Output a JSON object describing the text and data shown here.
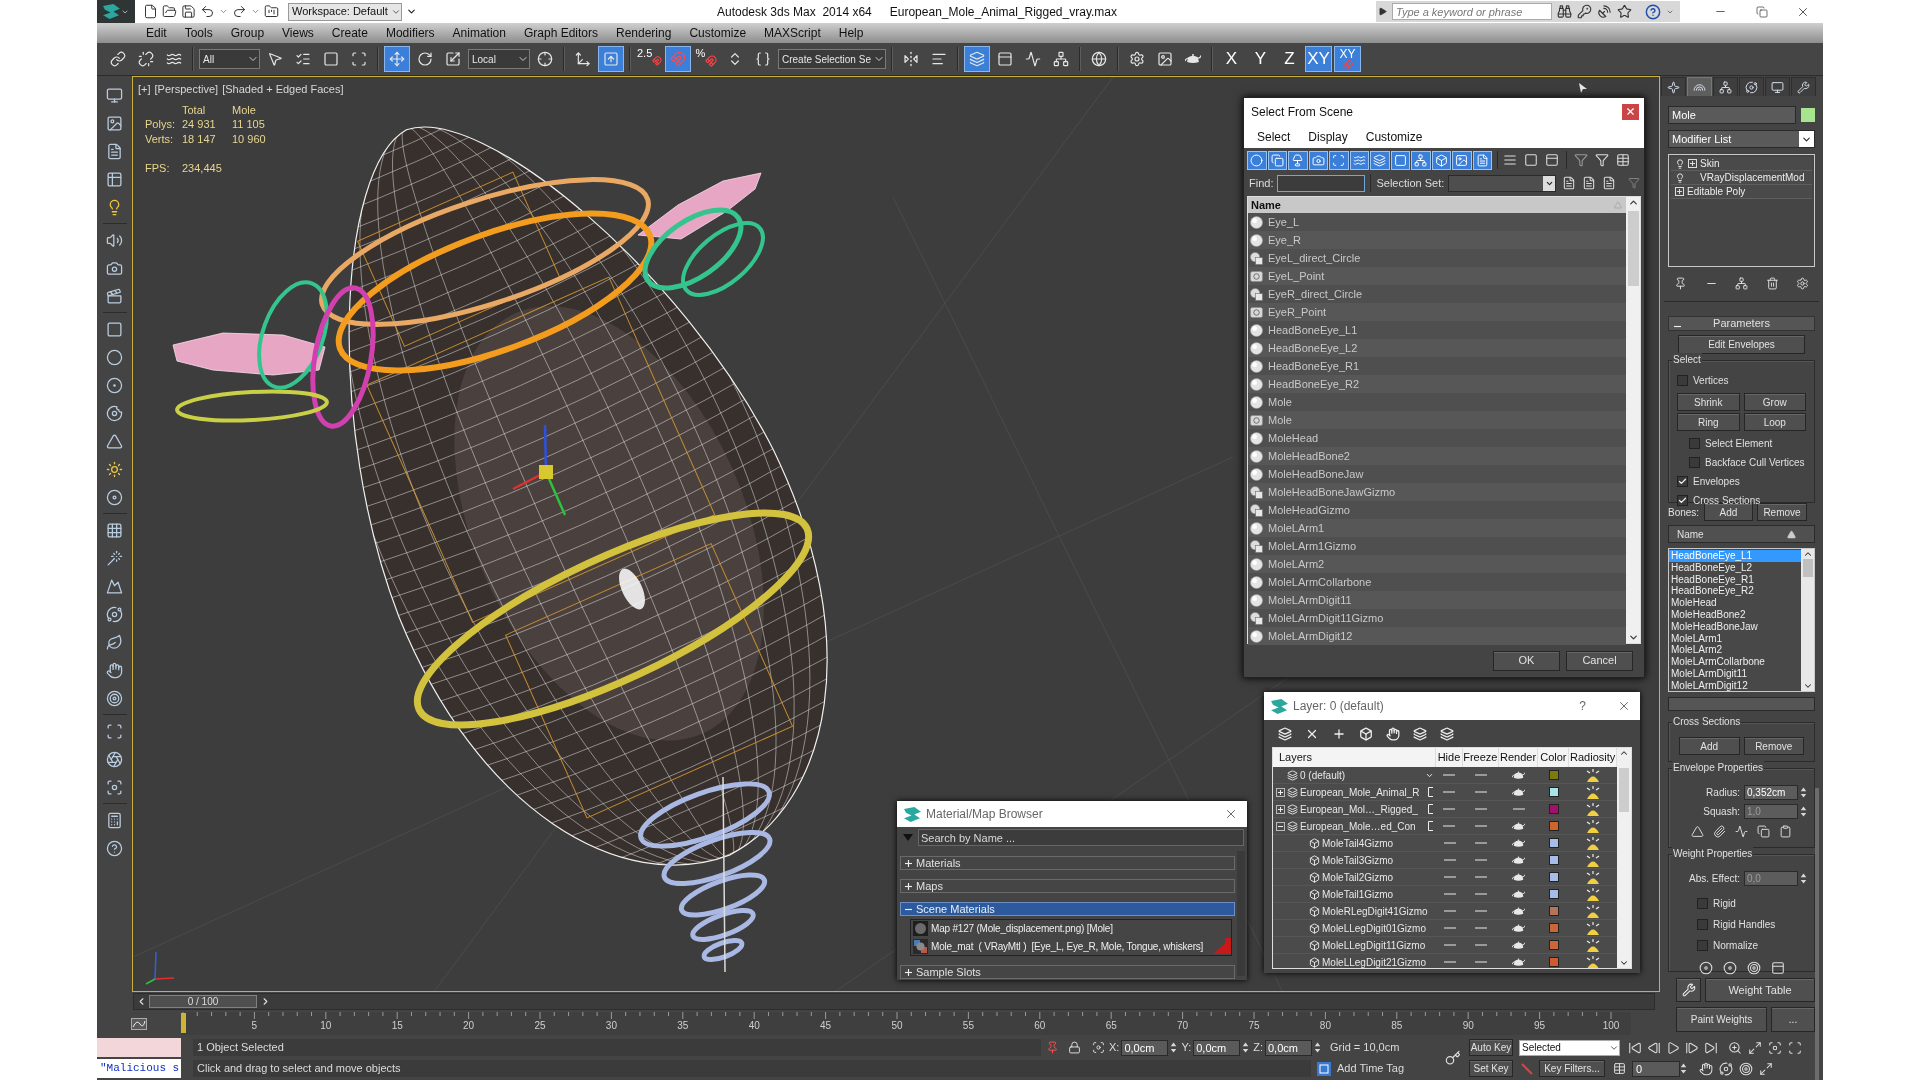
{
  "title_bar": {
    "workspace": "Workspace: Default",
    "app_title": "Autodesk 3ds Max  2014 x64",
    "file_name": "European_Mole_Animal_Rigged_vray.max",
    "search": {
      "placeholder": "Type a keyword or phrase"
    }
  },
  "menu": [
    "Edit",
    "Tools",
    "Group",
    "Views",
    "Create",
    "Modifiers",
    "Animation",
    "Graph Editors",
    "Rendering",
    "Customize",
    "MAXScript",
    "Help"
  ],
  "main_toolbar": [
    {
      "kind": "link",
      "selected": false
    },
    {
      "kind": "unlink",
      "selected": false
    },
    {
      "kind": "bind",
      "selected": false
    },
    {
      "kind": "dropdown",
      "value": "All"
    },
    {
      "kind": "select",
      "selected": false
    },
    {
      "kind": "select-by-name",
      "selected": false
    },
    {
      "kind": "region",
      "selected": false
    },
    {
      "kind": "crossing",
      "selected": false
    },
    {
      "kind": "move",
      "selected": true
    },
    {
      "kind": "rotate",
      "selected": false
    },
    {
      "kind": "scale",
      "selected": false
    },
    {
      "kind": "dropdown",
      "value": "Local"
    },
    {
      "kind": "pivot",
      "selected": false
    },
    {
      "kind": "manipulate",
      "selected": false
    },
    {
      "kind": "shortcut",
      "selected": true
    },
    {
      "kind": "snap",
      "label": "2.5",
      "selected": false
    },
    {
      "kind": "angle-snap",
      "selected": true
    },
    {
      "kind": "snap",
      "label": "%",
      "selected": false
    },
    {
      "kind": "spinner-snap",
      "selected": false
    },
    {
      "kind": "named-sets",
      "selected": false
    },
    {
      "kind": "dropdown",
      "value": "Create Selection Se"
    },
    {
      "kind": "mirror",
      "selected": false
    },
    {
      "kind": "align",
      "selected": false
    },
    {
      "kind": "layers",
      "selected": true
    },
    {
      "kind": "ribbon",
      "selected": false
    },
    {
      "kind": "curve-editor",
      "selected": false
    },
    {
      "kind": "schematic",
      "selected": false
    },
    {
      "kind": "material-editor",
      "selected": false
    },
    {
      "kind": "render-setup",
      "selected": false
    },
    {
      "kind": "frame-window",
      "selected": false
    },
    {
      "kind": "render",
      "selected": false
    },
    {
      "kind": "axis",
      "label": "X",
      "selected": false
    },
    {
      "kind": "axis",
      "label": "Y",
      "selected": false
    },
    {
      "kind": "axis",
      "label": "Z",
      "selected": false
    },
    {
      "kind": "axis",
      "label": "XY",
      "selected": true
    },
    {
      "kind": "axis-snap",
      "label": "XY",
      "selected": true
    }
  ],
  "viewport": {
    "labels": [
      "[+]",
      "[Perspective]",
      "[Shaded + Edged Faces]"
    ],
    "stats": {
      "columns": [
        "Total",
        "Mole"
      ],
      "rows": [
        {
          "label": "Polys:",
          "values": [
            "24 931",
            "11 105"
          ]
        },
        {
          "label": "Verts:",
          "values": [
            "18 147",
            "10 960"
          ]
        }
      ],
      "fps": {
        "label": "FPS:",
        "value": "234,445"
      }
    }
  },
  "select_from_scene": {
    "title": "Select From Scene",
    "menu": [
      "Select",
      "Display",
      "Customize"
    ],
    "filters": [
      {
        "selected": true
      },
      {
        "selected": true
      },
      {
        "selected": true
      },
      {
        "selected": true
      },
      {
        "selected": true
      },
      {
        "selected": true
      },
      {
        "selected": true
      },
      {
        "selected": true
      },
      {
        "selected": true
      },
      {
        "selected": true
      },
      {
        "selected": true
      },
      {
        "selected": true
      }
    ],
    "find_label": "Find:",
    "selection_set_label": "Selection Set:",
    "column": "Name",
    "rows": [
      {
        "name": "Eye_L",
        "kind": "geometry",
        "selected": false
      },
      {
        "name": "Eye_R",
        "kind": "geometry",
        "selected": false
      },
      {
        "name": "EyeL_direct_Circle",
        "kind": "shape",
        "selected": false
      },
      {
        "name": "EyeL_Point",
        "kind": "helper",
        "selected": false
      },
      {
        "name": "EyeR_direct_Circle",
        "kind": "shape",
        "selected": false
      },
      {
        "name": "EyeR_Point",
        "kind": "helper",
        "selected": false
      },
      {
        "name": "HeadBoneEye_L1",
        "kind": "geometry",
        "selected": false
      },
      {
        "name": "HeadBoneEye_L2",
        "kind": "geometry",
        "selected": false
      },
      {
        "name": "HeadBoneEye_R1",
        "kind": "geometry",
        "selected": false
      },
      {
        "name": "HeadBoneEye_R2",
        "kind": "geometry",
        "selected": false
      },
      {
        "name": "Mole",
        "kind": "geometry",
        "selected": false
      },
      {
        "name": "Mole",
        "kind": "helper",
        "selected": false
      },
      {
        "name": "MoleHead",
        "kind": "geometry",
        "selected": false
      },
      {
        "name": "MoleHeadBone2",
        "kind": "geometry",
        "selected": false
      },
      {
        "name": "MoleHeadBoneJaw",
        "kind": "geometry",
        "selected": false
      },
      {
        "name": "MoleHeadBoneJawGizmo",
        "kind": "shape",
        "selected": false
      },
      {
        "name": "MoleHeadGizmo",
        "kind": "shape",
        "selected": false
      },
      {
        "name": "MoleLArm1",
        "kind": "geometry",
        "selected": false
      },
      {
        "name": "MoleLArm1Gizmo",
        "kind": "shape",
        "selected": false
      },
      {
        "name": "MoleLArm2",
        "kind": "geometry",
        "selected": false
      },
      {
        "name": "MoleLArmCollarbone",
        "kind": "geometry",
        "selected": false
      },
      {
        "name": "MoleLArmDigit11",
        "kind": "geometry",
        "selected": false
      },
      {
        "name": "MoleLArmDigit11Gizmo",
        "kind": "shape",
        "selected": false
      },
      {
        "name": "MoleLArmDigit12",
        "kind": "geometry",
        "selected": false
      }
    ],
    "buttons": [
      "OK",
      "Cancel"
    ]
  },
  "command_panel": {
    "tabs": [
      {
        "selected": false
      },
      {
        "selected": true
      },
      {
        "selected": false
      },
      {
        "selected": false
      },
      {
        "selected": false
      },
      {
        "selected": false
      }
    ],
    "object": {
      "name": "Mole",
      "color": "#a6e48e"
    },
    "modifier_list": "Modifier List",
    "stack": [
      {
        "name": "Skin",
        "kind": "modifier",
        "expanded": false
      },
      {
        "name": "VRayDisplacementMod",
        "kind": "modifier"
      },
      {
        "name": "Editable Poly",
        "kind": "base",
        "expanded": false
      }
    ],
    "parameters": {
      "title": "Parameters",
      "edit_envelopes": "Edit Envelopes",
      "select_title": "Select",
      "vertices": {
        "label": "Vertices",
        "checked": false
      },
      "select_buttons": [
        "Shrink",
        "Grow",
        "Ring",
        "Loop"
      ],
      "options": [
        {
          "label": "Select Element",
          "checked": false
        },
        {
          "label": "Backface Cull Vertices",
          "checked": false
        },
        {
          "label": "Envelopes",
          "checked": true
        },
        {
          "label": "Cross Sections",
          "checked": true
        }
      ],
      "bones_label": "Bones:",
      "bones_buttons": [
        "Add",
        "Remove"
      ],
      "bones_column": "Name",
      "bones": [
        {
          "name": "HeadBoneEye_L1",
          "selected": true
        },
        {
          "name": "HeadBoneEye_L2",
          "selected": false
        },
        {
          "name": "HeadBoneEye_R1",
          "selected": false
        },
        {
          "name": "HeadBoneEye_R2",
          "selected": false
        },
        {
          "name": "MoleHead",
          "selected": false
        },
        {
          "name": "MoleHeadBone2",
          "selected": false
        },
        {
          "name": "MoleHeadBoneJaw",
          "selected": false
        },
        {
          "name": "MoleLArm1",
          "selected": false
        },
        {
          "name": "MoleLArm2",
          "selected": false
        },
        {
          "name": "MoleLArmCollarbone",
          "selected": false
        },
        {
          "name": "MoleLArmDigit11",
          "selected": false
        },
        {
          "name": "MoleLArmDigit12",
          "selected": false
        }
      ]
    },
    "cross_sections": {
      "title": "Cross Sections",
      "buttons": [
        "Add",
        "Remove"
      ]
    },
    "envelope_properties": {
      "title": "Envelope Properties",
      "fields": [
        {
          "label": "Radius:",
          "value": "0,352cm",
          "disabled": false
        },
        {
          "label": "Squash:",
          "value": "1,0",
          "disabled": true
        }
      ]
    },
    "weight_properties": {
      "title": "Weight Properties",
      "abs_effect": {
        "label": "Abs. Effect:",
        "value": "0,0",
        "disabled": true
      },
      "options": [
        {
          "label": "Rigid",
          "checked": false
        },
        {
          "label": "Rigid Handles",
          "checked": false
        },
        {
          "label": "Normalize",
          "checked": false
        }
      ],
      "weight_table": "Weight Table",
      "paint_weights": "Paint Weights",
      "more": "..."
    }
  },
  "material_browser": {
    "title": "Material/Map Browser",
    "search": {
      "placeholder": "Search by Name ..."
    },
    "groups": [
      {
        "label": "Materials",
        "expanded": false,
        "selected": false
      },
      {
        "label": "Maps",
        "expanded": false,
        "selected": false
      },
      {
        "label": "Scene Materials",
        "expanded": true,
        "selected": true,
        "items": [
          {
            "label": "Map #127 (Mole_displacement.png) [Mole]",
            "kind": "map",
            "flagged": false
          },
          {
            "label": "Mole_mat  ( VRayMtl )  [Eye_L, Eye_R, Mole, Tongue, whiskers]",
            "kind": "material",
            "flagged": true
          }
        ]
      },
      {
        "label": "Sample Slots",
        "expanded": false,
        "selected": false
      }
    ]
  },
  "layer_dialog": {
    "title": "Layer: 0 (default)",
    "help": "?",
    "columns": [
      "Layers",
      "Hide",
      "Freeze",
      "Render",
      "Color",
      "Radiosity"
    ],
    "rows": [
      {
        "name": "0 (default)",
        "kind": "layer",
        "current": true,
        "hidden": false,
        "frozen": false,
        "render": true,
        "color": "#7b7b10"
      },
      {
        "name": "European_Mole_Animal_R",
        "kind": "layer",
        "current": false,
        "expanded": false,
        "hidden": false,
        "frozen": false,
        "render": true,
        "color": "#a8e6e6"
      },
      {
        "name": "European_Mol…_Rigged_",
        "kind": "layer",
        "current": false,
        "expanded": false,
        "hidden": false,
        "frozen": false,
        "render": false,
        "color": "#a2106c"
      },
      {
        "name": "European_Mole…ed_Con",
        "kind": "layer",
        "current": false,
        "expanded": true,
        "hidden": false,
        "frozen": false,
        "render": true,
        "color": "#d0642c",
        "children": [
          {
            "name": "MoleTail4Gizmo",
            "kind": "object",
            "hidden": false,
            "frozen": false,
            "render": true,
            "color": "#a8bce8"
          },
          {
            "name": "MoleTail3Gizmo",
            "kind": "object",
            "hidden": false,
            "frozen": false,
            "render": true,
            "color": "#a8bce8"
          },
          {
            "name": "MoleTail2Gizmo",
            "kind": "object",
            "hidden": false,
            "frozen": false,
            "render": true,
            "color": "#a8bce8"
          },
          {
            "name": "MoleTail1Gizmo",
            "kind": "object",
            "hidden": false,
            "frozen": false,
            "render": true,
            "color": "#a8bce8"
          },
          {
            "name": "MoleRLegDigit41Gizmo",
            "kind": "object",
            "hidden": false,
            "frozen": false,
            "render": true,
            "color": "#b4745a"
          },
          {
            "name": "MoleLLegDigit01Gizmo",
            "kind": "object",
            "hidden": false,
            "frozen": false,
            "render": true,
            "color": "#cc6638"
          },
          {
            "name": "MoleLLegDigit11Gizmo",
            "kind": "object",
            "hidden": false,
            "frozen": false,
            "render": true,
            "color": "#cc6638"
          },
          {
            "name": "MoleLLegDigit21Gizmo",
            "kind": "object",
            "hidden": false,
            "frozen": false,
            "render": true,
            "color": "#d05a30"
          }
        ]
      }
    ]
  },
  "time_slider": {
    "label": "0 / 100",
    "level": 0
  },
  "track_bar": {
    "labels": [
      "5",
      "10",
      "15",
      "20",
      "25",
      "30",
      "35",
      "40",
      "45",
      "50",
      "55",
      "60",
      "65",
      "70",
      "75",
      "80",
      "85",
      "90",
      "95",
      "100"
    ]
  },
  "status_bar": {
    "listener": "\"Malicious s",
    "selection": "1 Object Selected",
    "prompt": "Click and drag to select and move objects",
    "coords": [
      {
        "label": "X:",
        "value": "0,0cm"
      },
      {
        "label": "Y:",
        "value": "0,0cm"
      },
      {
        "label": "Z:",
        "value": "0,0cm"
      }
    ],
    "grid": "Grid = 10,0cm",
    "add_time_tag": "Add Time Tag",
    "auto_key": {
      "label": "Auto Key",
      "on": false
    },
    "set_key": "Set Key",
    "key_mode": "Selected",
    "key_filters": "Key Filters...",
    "frame": "0"
  }
}
